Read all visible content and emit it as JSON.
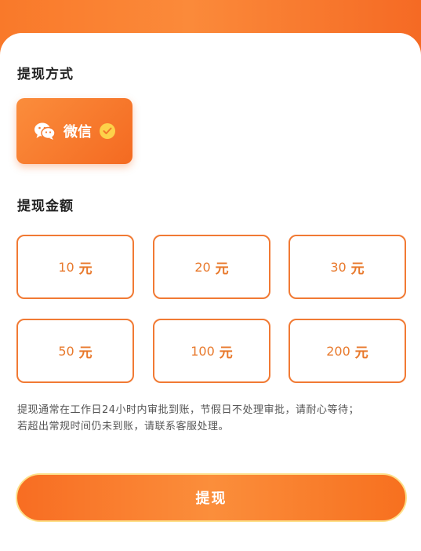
{
  "header": {},
  "withdraw_method": {
    "title": "提现方式",
    "selected": {
      "label": "微信",
      "icon": "wechat-icon"
    }
  },
  "withdraw_amount": {
    "title": "提现金额",
    "options": [
      {
        "value": "10",
        "unit": "元"
      },
      {
        "value": "20",
        "unit": "元"
      },
      {
        "value": "30",
        "unit": "元"
      },
      {
        "value": "50",
        "unit": "元"
      },
      {
        "value": "100",
        "unit": "元"
      },
      {
        "value": "200",
        "unit": "元"
      }
    ]
  },
  "notice": {
    "line1": "提现通常在工作日24小时内审批到账，节假日不处理审批，请耐心等待；",
    "line2": "若超出常规时间仍未到账，请联系客服处理。"
  },
  "submit": {
    "label": "提现"
  },
  "colors": {
    "accent": "#f87a2e",
    "accent_dark": "#f46a21",
    "check": "#fdd24a"
  }
}
